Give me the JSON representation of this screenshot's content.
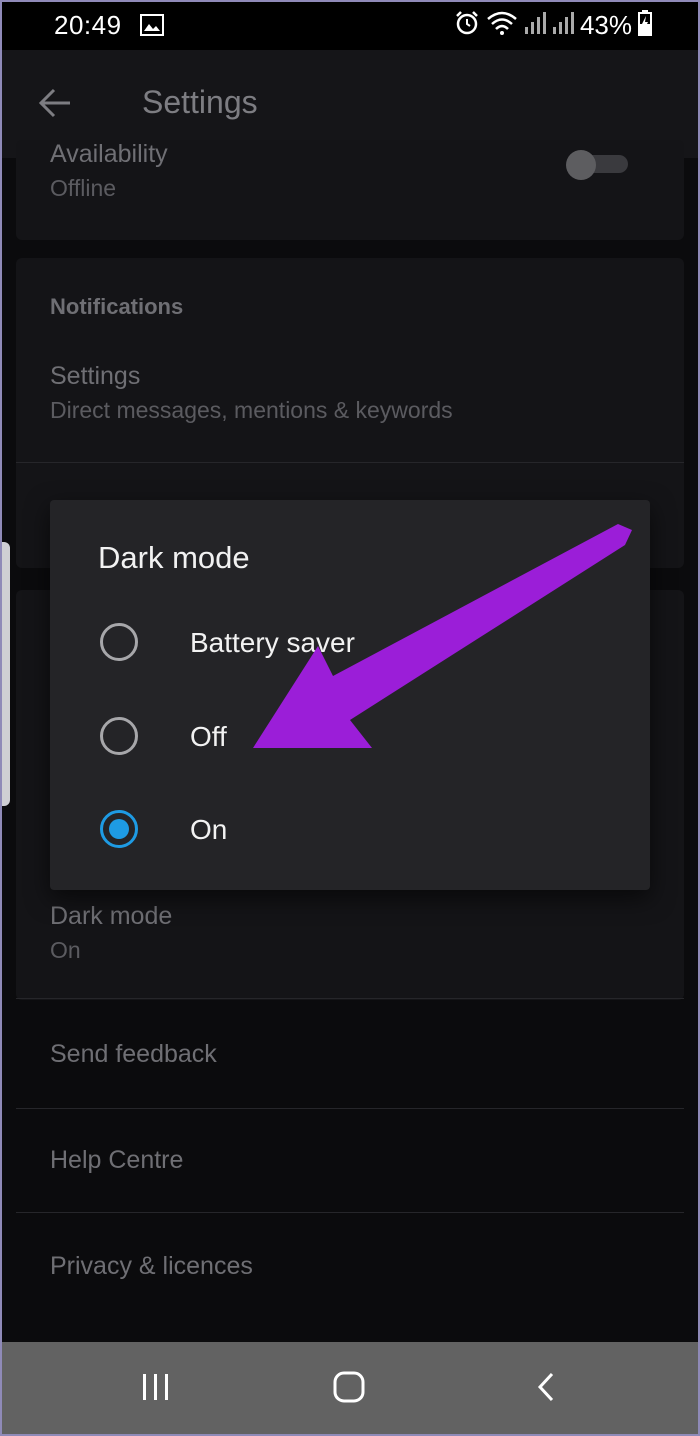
{
  "status": {
    "time": "20:49",
    "battery": "43%"
  },
  "app_bar": {
    "title": "Settings"
  },
  "list": {
    "availability": {
      "title": "Availability",
      "subtitle": "Offline"
    },
    "notifications_header": "Notifications",
    "notification_settings": {
      "title": "Settings",
      "subtitle": "Direct messages, mentions & keywords"
    },
    "dark_mode": {
      "title": "Dark mode",
      "subtitle": "On"
    },
    "send_feedback": "Send feedback",
    "help_centre": "Help Centre",
    "privacy": "Privacy & licences"
  },
  "dialog": {
    "title": "Dark mode",
    "options": [
      {
        "label": "Battery saver",
        "selected": false
      },
      {
        "label": "Off",
        "selected": false
      },
      {
        "label": "On",
        "selected": true
      }
    ]
  },
  "colors": {
    "accent": "#1e9be4",
    "annotation_arrow": "#9b1ed8"
  },
  "icons": [
    "image-icon",
    "alarm-icon",
    "wifi-icon",
    "signal-icon",
    "battery-charging-icon",
    "back-arrow-icon",
    "recent-apps-icon",
    "home-icon",
    "nav-back-icon"
  ]
}
